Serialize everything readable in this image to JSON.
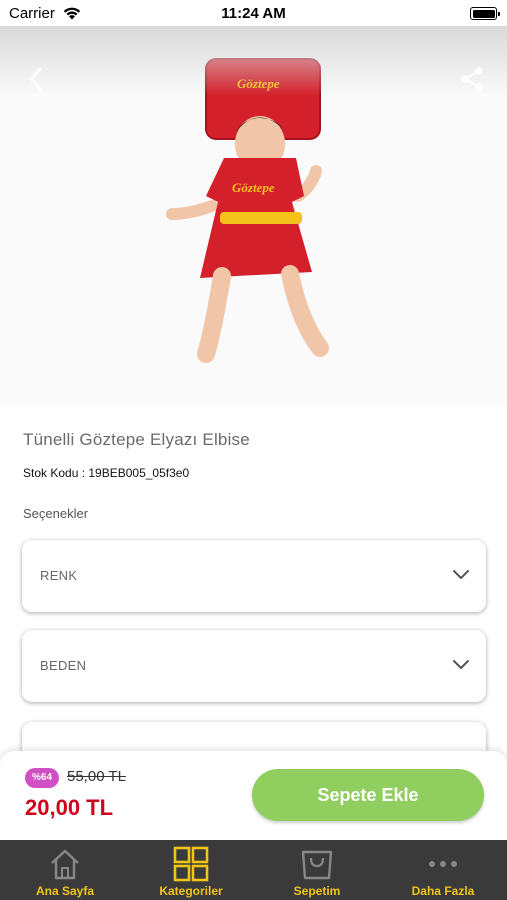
{
  "status_bar": {
    "carrier": "Carrier",
    "time": "11:24 AM"
  },
  "product": {
    "title": "Tünelli Göztepe Elyazı Elbise",
    "sku_label": "Stok Kodu : 19BEB005_05f3e0",
    "options_label": "Seçenekler",
    "image_text": "Göztepe"
  },
  "options": {
    "color_label": "RENK",
    "size_label": "BEDEN"
  },
  "pricing": {
    "discount": "%64",
    "old_price": "55,00 TL",
    "new_price": "20,00 TL",
    "add_to_cart": "Sepete Ekle"
  },
  "tabs": [
    {
      "label": "Ana Sayfa",
      "icon": "home-icon"
    },
    {
      "label": "Kategoriler",
      "icon": "grid-icon"
    },
    {
      "label": "Sepetim",
      "icon": "shopping-bag-icon"
    },
    {
      "label": "Daha Fazla",
      "icon": "more-icon"
    }
  ],
  "colors": {
    "accent_yellow": "#f0c419",
    "price_red": "#d0021b",
    "cart_green": "#8fce5f",
    "badge_pink": "#d14fc5",
    "tab_bar": "#3a3a3a"
  }
}
